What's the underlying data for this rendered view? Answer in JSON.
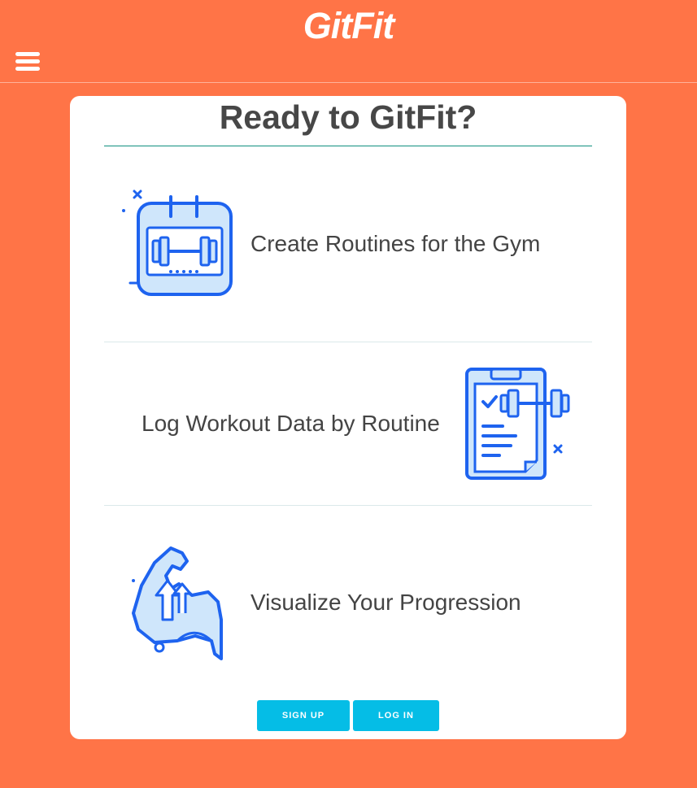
{
  "header": {
    "brand": "GitFit",
    "menu_icon": "hamburger-menu-icon"
  },
  "card": {
    "title": "Ready to GitFit?"
  },
  "features": [
    {
      "label": "Create Routines for the Gym",
      "icon": "calendar-dumbbell-icon"
    },
    {
      "label": "Log Workout Data by Routine",
      "icon": "clipboard-dumbbell-icon"
    },
    {
      "label": "Visualize Your Progression",
      "icon": "flexed-arm-icon"
    }
  ],
  "actions": {
    "signup_label": "SIGN UP",
    "login_label": "LOG IN"
  },
  "colors": {
    "background": "#ff7447",
    "card": "#ffffff",
    "button": "#05bde6",
    "icon_blue": "#1e63ef",
    "icon_fill": "#cfe6fb",
    "title_text": "#474747",
    "title_rule": "#0f8f80"
  }
}
